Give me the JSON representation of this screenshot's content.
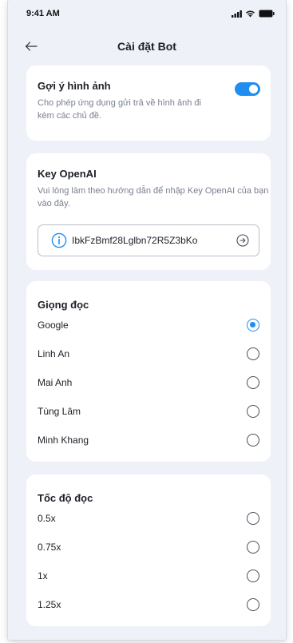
{
  "status_bar": {
    "time": "9:41 AM"
  },
  "header": {
    "title": "Cài đặt Bot"
  },
  "image_suggestion": {
    "title": "Gợi ý hình ảnh",
    "description": "Cho phép ứng dụng gửi trả về hình ảnh đi kèm các chủ đề.",
    "enabled": true
  },
  "openai_key": {
    "title": "Key OpenAI",
    "description": "Vui lòng làm theo hướng dẫn để nhập Key OpenAI của bạn vào đây.",
    "value": "IbkFzBmf28Lglbn72R5Z3bKo"
  },
  "voice": {
    "title": "Giọng đọc",
    "options": [
      {
        "label": "Google",
        "selected": true
      },
      {
        "label": "Linh An",
        "selected": false
      },
      {
        "label": "Mai Anh",
        "selected": false
      },
      {
        "label": "Tùng Lâm",
        "selected": false
      },
      {
        "label": "Minh Khang",
        "selected": false
      }
    ]
  },
  "speed": {
    "title": "Tốc độ đọc",
    "options": [
      {
        "label": "0.5x",
        "selected": false
      },
      {
        "label": "0.75x",
        "selected": false
      },
      {
        "label": "1x",
        "selected": false
      },
      {
        "label": "1.25x",
        "selected": false
      }
    ]
  },
  "colors": {
    "accent": "#1f8ef1",
    "background": "#eef2f8",
    "card": "#ffffff"
  }
}
